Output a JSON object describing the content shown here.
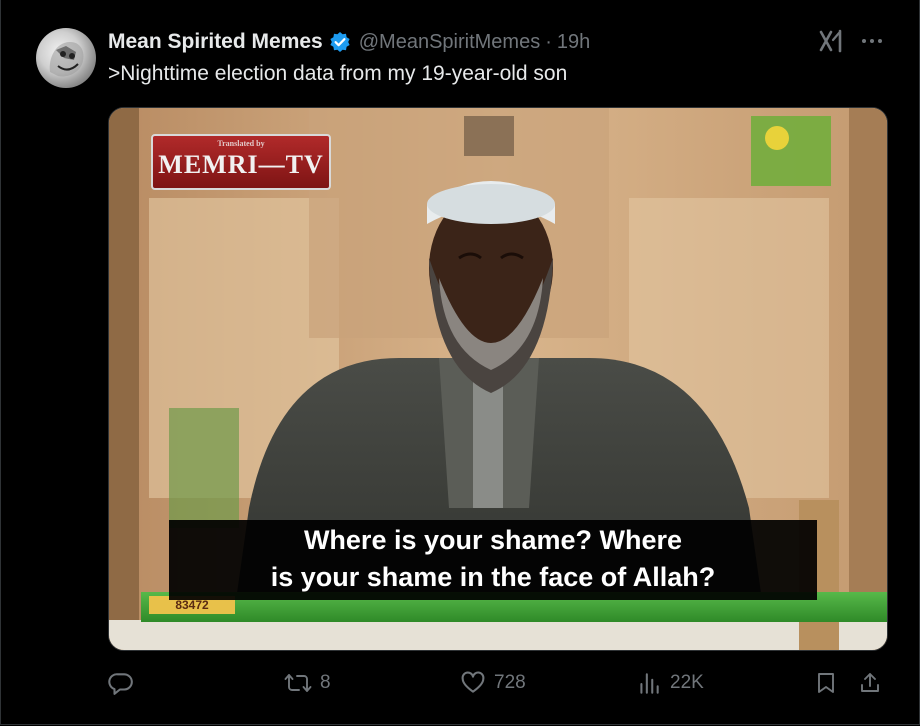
{
  "tweet": {
    "author_name": "Mean Spirited Memes",
    "handle": "@MeanSpiritMemes",
    "separator": "·",
    "time": "19h",
    "text": ">Nighttime election data from my 19-year-old son",
    "verified": true
  },
  "media": {
    "logo_small_text": "Translated by",
    "logo_text": "MEMRI—TV",
    "caption_line1": "Where is your shame? Where",
    "caption_line2": "is your shame in the face of Allah?",
    "ticker_id": "83472"
  },
  "actions": {
    "reply_count": "",
    "retweet_count": "8",
    "like_count": "728",
    "views_count": "22K"
  },
  "icons": {
    "verified": "verified-badge-icon",
    "grok": "grok-icon",
    "more": "more-icon",
    "reply": "reply-icon",
    "retweet": "retweet-icon",
    "like": "like-icon",
    "views": "views-icon",
    "bookmark": "bookmark-icon",
    "share": "share-icon"
  },
  "colors": {
    "background": "#000000",
    "text_primary": "#e7e9ea",
    "text_secondary": "#71767b",
    "verified_blue": "#1d9bf0"
  }
}
